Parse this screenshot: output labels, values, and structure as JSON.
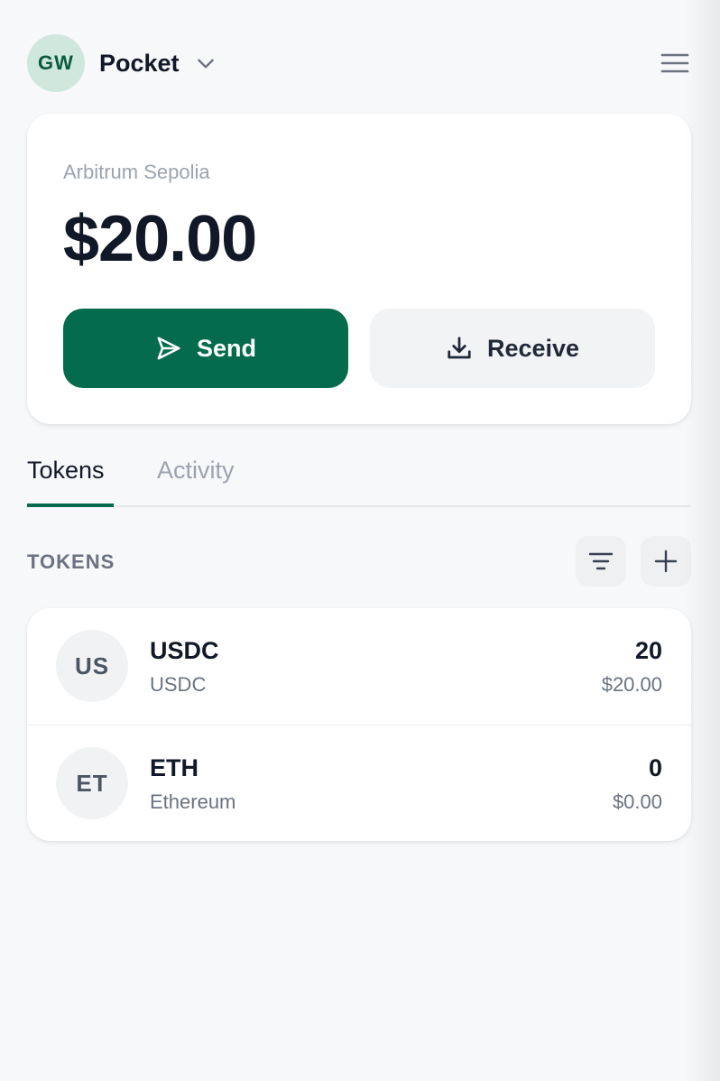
{
  "header": {
    "avatar_initials": "GW",
    "wallet_name": "Pocket",
    "switcher_icon": "chevron-down-icon",
    "menu_icon": "hamburger-menu-icon"
  },
  "balance_card": {
    "network": "Arbitrum Sepolia",
    "balance": "$20.00",
    "send_label": "Send",
    "send_icon": "paper-plane-icon",
    "receive_label": "Receive",
    "receive_icon": "download-icon"
  },
  "tabs": [
    {
      "label": "Tokens",
      "active": true
    },
    {
      "label": "Activity",
      "active": false
    }
  ],
  "tokens_section": {
    "label": "TOKENS",
    "filter_icon": "filter-icon",
    "add_icon": "plus-icon",
    "items": [
      {
        "initials": "US",
        "symbol": "USDC",
        "name": "USDC",
        "amount": "20",
        "value": "$20.00"
      },
      {
        "initials": "ET",
        "symbol": "ETH",
        "name": "Ethereum",
        "amount": "0",
        "value": "$0.00"
      }
    ]
  },
  "colors": {
    "brand_green": "#046b4c",
    "avatar_bg": "#cfe7dc",
    "page_bg": "#f7f8fa"
  }
}
